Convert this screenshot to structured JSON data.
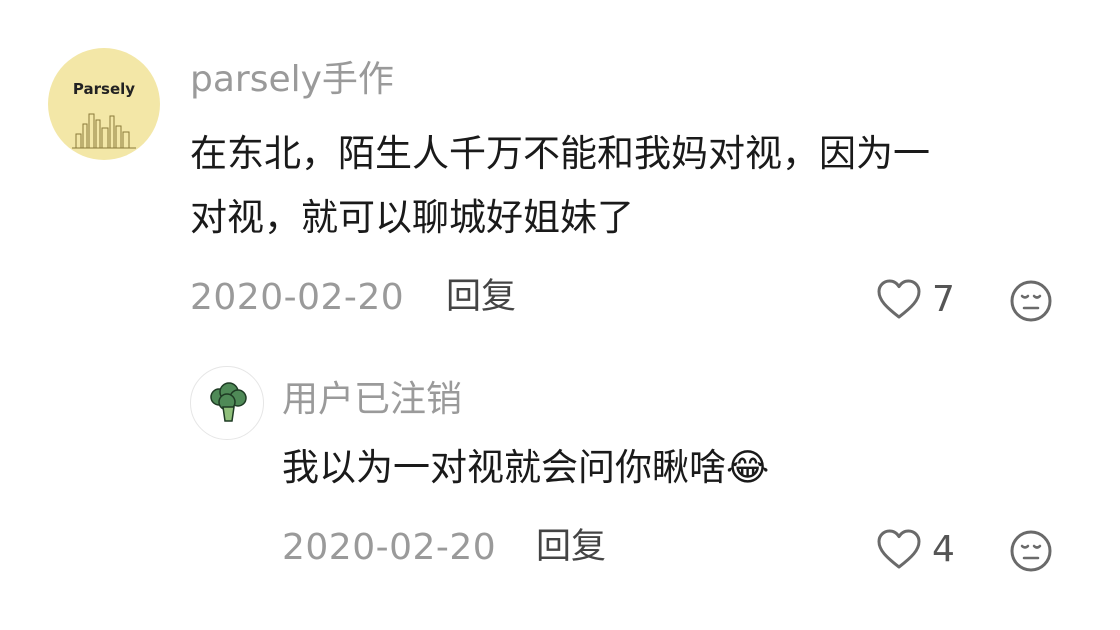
{
  "comments": [
    {
      "username": "parsely手作",
      "avatar_text": "Parsely",
      "content_line1": "在东北，陌生人千万不能和我妈对视，因为一",
      "content_line2": "对视，就可以聊城好姐妹了",
      "date": "2020-02-20",
      "reply_label": "回复",
      "likes": "7"
    },
    {
      "username": "用户已注销",
      "avatar_icon": "broccoli-icon",
      "content": "我以为一对视就会问你瞅啥😂",
      "date": "2020-02-20",
      "reply_label": "回复",
      "likes": "4"
    }
  ],
  "colors": {
    "muted_text": "#9a9a9a",
    "body_text": "#1a1a1a",
    "avatar_bg": "#f3e7a7",
    "broccoli": "#4f8a57"
  }
}
